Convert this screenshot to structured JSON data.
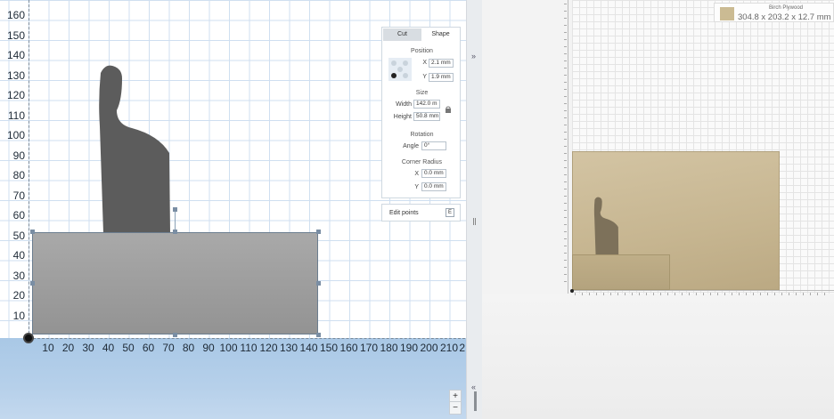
{
  "canvas": {
    "y_ticks": [
      "160",
      "150",
      "140",
      "130",
      "120",
      "110",
      "100",
      "90",
      "80",
      "70",
      "60",
      "50",
      "40",
      "30",
      "20",
      "10"
    ],
    "x_ticks": [
      "10",
      "20",
      "30",
      "40",
      "50",
      "60",
      "70",
      "80",
      "90",
      "100",
      "110",
      "120",
      "130",
      "140",
      "150",
      "160",
      "170",
      "180",
      "190",
      "200",
      "210",
      "2"
    ]
  },
  "shape_panel": {
    "tab_cut": "Cut",
    "tab_shape": "Shape",
    "position_label": "Position",
    "x_label": "X",
    "x_value": "2.1 mm",
    "y_label": "Y",
    "y_value": "1.9 mm",
    "size_label": "Size",
    "width_label": "Width",
    "width_value": "142.0 m",
    "height_label": "Height",
    "height_value": "50.8 mm",
    "rotation_label": "Rotation",
    "angle_label": "Angle",
    "angle_value": "0°",
    "corner_radius_label": "Corner Radius",
    "cr_x_label": "X",
    "cr_x_value": "0.0 mm",
    "cr_y_label": "Y",
    "cr_y_value": "0.0 mm"
  },
  "edit_points": {
    "label": "Edit points",
    "button": "E"
  },
  "zoom": {
    "plus": "+",
    "minus": "−"
  },
  "strip": {
    "expand": "»",
    "collapse": "«"
  },
  "preview": {
    "material_name": "Birch Plywood",
    "material_dims": "304.8 x 203.2 x 12.7 mm",
    "material_color": "#cbbb93"
  },
  "colors": {
    "accent": "#1a4e8a",
    "shape_fill": "#999999",
    "figure_fill": "#5c5c5c"
  }
}
